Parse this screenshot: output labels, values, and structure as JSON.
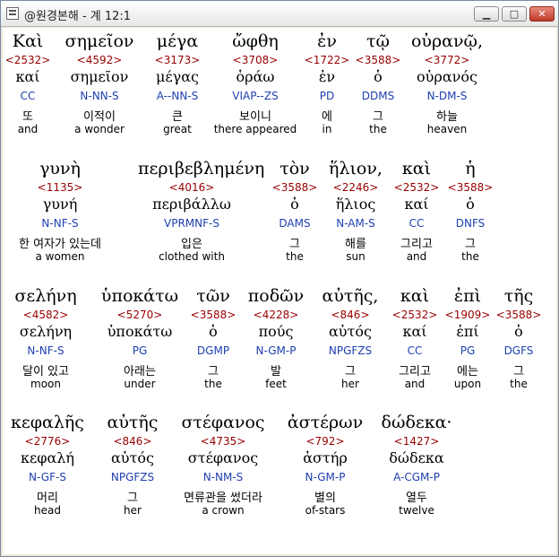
{
  "window": {
    "title": "@원경본해 - 계 12:1",
    "min_label": "▁",
    "max_label": "□",
    "close_label": "✕"
  },
  "rows": [
    [
      {
        "greek": "Καὶ",
        "strongs": "<2532>",
        "lemma": "καί",
        "parsing": "CC",
        "korean": "또",
        "english": "and"
      },
      {
        "greek": "σημεῖον",
        "strongs": "<4592>",
        "lemma": "σημεῖον",
        "parsing": "N-NN-S",
        "korean": "이적이",
        "english": "a wonder"
      },
      {
        "greek": "μέγα",
        "strongs": "<3173>",
        "lemma": "μέγας",
        "parsing": "A--NN-S",
        "korean": "큰",
        "english": "great"
      },
      {
        "greek": "ὤφθη",
        "strongs": "<3708>",
        "lemma": "ὁράω",
        "parsing": "VIAP--ZS",
        "korean": "보이니",
        "english": "there appeared"
      },
      {
        "greek": "ἐν",
        "strongs": "<1722>",
        "lemma": "ἐν",
        "parsing": "PD",
        "korean": "에",
        "english": "in"
      },
      {
        "greek": "τῷ",
        "strongs": "<3588>",
        "lemma": "ὁ",
        "parsing": "DDMS",
        "korean": "그",
        "english": "the"
      },
      {
        "greek": "οὐρανῷ,",
        "strongs": "<3772>",
        "lemma": "οὐρανός",
        "parsing": "N-DM-S",
        "korean": "하늘",
        "english": "heaven"
      }
    ],
    [
      {
        "greek": "γυνὴ",
        "strongs": "<1135>",
        "lemma": "γυνή",
        "parsing": "N-NF-S",
        "korean": "한 여자가 있는데",
        "english": "a women"
      },
      {
        "greek": "περιβεβλημένη",
        "strongs": "<4016>",
        "lemma": "περιβάλλω",
        "parsing": "VPRMNF-S",
        "korean": "입은",
        "english": "clothed with"
      },
      {
        "greek": "τὸν",
        "strongs": "<3588>",
        "lemma": "ὁ",
        "parsing": "DAMS",
        "korean": "그",
        "english": "the"
      },
      {
        "greek": "ἥλιον,",
        "strongs": "<2246>",
        "lemma": "ἥλιος",
        "parsing": "N-AM-S",
        "korean": "해를",
        "english": "sun"
      },
      {
        "greek": "καὶ",
        "strongs": "<2532>",
        "lemma": "καί",
        "parsing": "CC",
        "korean": "그리고",
        "english": "and"
      },
      {
        "greek": "ἡ",
        "strongs": "<3588>",
        "lemma": "ὁ",
        "parsing": "DNFS",
        "korean": "그",
        "english": "the"
      }
    ],
    [
      {
        "greek": "σελήνη",
        "strongs": "<4582>",
        "lemma": "σελήνη",
        "parsing": "N-NF-S",
        "korean": "달이 있고",
        "english": "moon"
      },
      {
        "greek": "ὑποκάτω",
        "strongs": "<5270>",
        "lemma": "ὑποκάτω",
        "parsing": "PG",
        "korean": "아래는",
        "english": "under"
      },
      {
        "greek": "τῶν",
        "strongs": "<3588>",
        "lemma": "ὁ",
        "parsing": "DGMP",
        "korean": "그",
        "english": "the"
      },
      {
        "greek": "ποδῶν",
        "strongs": "<4228>",
        "lemma": "πούς",
        "parsing": "N-GM-P",
        "korean": "발",
        "english": "feet"
      },
      {
        "greek": "αὐτῆς,",
        "strongs": "<846>",
        "lemma": "αὐτός",
        "parsing": "NPGFZS",
        "korean": "그",
        "english": "her"
      },
      {
        "greek": "καὶ",
        "strongs": "<2532>",
        "lemma": "καί",
        "parsing": "CC",
        "korean": "그리고",
        "english": "and"
      },
      {
        "greek": "ἐπὶ",
        "strongs": "<1909>",
        "lemma": "ἐπί",
        "parsing": "PG",
        "korean": "에는",
        "english": "upon"
      },
      {
        "greek": "τῆς",
        "strongs": "<3588>",
        "lemma": "ὁ",
        "parsing": "DGFS",
        "korean": "그",
        "english": "the"
      }
    ],
    [
      {
        "greek": "κεφαλῆς",
        "strongs": "<2776>",
        "lemma": "κεφαλή",
        "parsing": "N-GF-S",
        "korean": "머리",
        "english": "head"
      },
      {
        "greek": "αὐτῆς",
        "strongs": "<846>",
        "lemma": "αὐτός",
        "parsing": "NPGFZS",
        "korean": "그",
        "english": "her"
      },
      {
        "greek": "στέφανος",
        "strongs": "<4735>",
        "lemma": "στέφανος",
        "parsing": "N-NM-S",
        "korean": "면류관을 썼더라",
        "english": "a crown"
      },
      {
        "greek": "ἀστέρων",
        "strongs": "<792>",
        "lemma": "ἀστήρ",
        "parsing": "N-GM-P",
        "korean": "별의",
        "english": "of-stars"
      },
      {
        "greek": "δώδεκα·",
        "strongs": "<1427>",
        "lemma": "δώδεκα",
        "parsing": "A-CGM-P",
        "korean": "열두",
        "english": "twelve"
      }
    ]
  ]
}
